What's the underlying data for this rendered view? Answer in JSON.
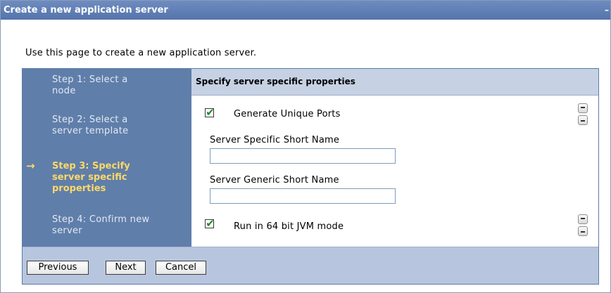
{
  "window": {
    "title": "Create a new application server",
    "minimize_glyph": "–"
  },
  "intro_text": "Use this page to create a new application server.",
  "wizard": {
    "steps": [
      {
        "line1": "Step 1: Select a",
        "line2": "node",
        "line3": ""
      },
      {
        "line1": "Step 2: Select a",
        "line2": "server template",
        "line3": ""
      },
      {
        "line1": "Step 3: Specify",
        "line2": "server specific",
        "line3": "properties"
      },
      {
        "line1": "Step 4: Confirm new",
        "line2": "server",
        "line3": ""
      }
    ],
    "active_step_index": 2,
    "current_arrow": "→",
    "section_title": "Specify server specific properties",
    "generate_unique_ports": {
      "label": "Generate Unique Ports",
      "checked": true
    },
    "server_specific_short_name": {
      "label": "Server Specific Short Name",
      "value": ""
    },
    "server_generic_short_name": {
      "label": "Server Generic Short Name",
      "value": ""
    },
    "run_64bit_jvm": {
      "label": "Run in 64 bit JVM mode",
      "checked": true
    },
    "check_glyph": "✔"
  },
  "buttons": {
    "previous": "Previous",
    "next": "Next",
    "cancel": "Cancel"
  },
  "colors": {
    "title_bar": "#5f7eb6",
    "steps_panel": "#5f7eaa",
    "active_step": "#ffd966",
    "header_band": "#c6d2e4",
    "footer_band": "#b7c6de"
  }
}
